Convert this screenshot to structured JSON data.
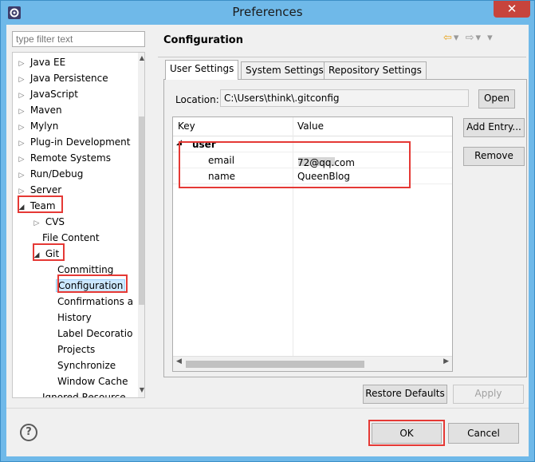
{
  "window": {
    "title": "Preferences",
    "close_glyph": "✕",
    "icon": "eclipse-gear-icon"
  },
  "filter": {
    "placeholder": "type filter text"
  },
  "tree": {
    "items": [
      {
        "label": "Java EE",
        "twisty": "▷"
      },
      {
        "label": "Java Persistence",
        "twisty": "▷"
      },
      {
        "label": "JavaScript",
        "twisty": "▷"
      },
      {
        "label": "Maven",
        "twisty": "▷"
      },
      {
        "label": "Mylyn",
        "twisty": "▷"
      },
      {
        "label": "Plug-in Development",
        "twisty": "▷"
      },
      {
        "label": "Remote Systems",
        "twisty": "▷"
      },
      {
        "label": "Run/Debug",
        "twisty": "▷"
      },
      {
        "label": "Server",
        "twisty": "▷"
      },
      {
        "label": "Team",
        "twisty": "◢"
      },
      {
        "label": "CVS",
        "twisty": "▷"
      },
      {
        "label": "File Content",
        "twisty": ""
      },
      {
        "label": "Git",
        "twisty": "◢"
      },
      {
        "label": "Committing",
        "twisty": ""
      },
      {
        "label": "Configuration",
        "twisty": ""
      },
      {
        "label": "Confirmations a",
        "twisty": ""
      },
      {
        "label": "History",
        "twisty": ""
      },
      {
        "label": "Label Decoratio",
        "twisty": ""
      },
      {
        "label": "Projects",
        "twisty": ""
      },
      {
        "label": "Synchronize",
        "twisty": ""
      },
      {
        "label": "Window Cache",
        "twisty": ""
      },
      {
        "label": "Ignored Resource",
        "twisty": ""
      }
    ]
  },
  "header": {
    "title": "Configuration"
  },
  "tabs": [
    {
      "label": "User Settings"
    },
    {
      "label": "System Settings"
    },
    {
      "label": "Repository Settings"
    }
  ],
  "location": {
    "label": "Location:",
    "value": "C:\\Users\\think\\.gitconfig",
    "open_label": "Open"
  },
  "table": {
    "col_key": "Key",
    "col_value": "Value",
    "section": "user",
    "rows": [
      {
        "key": "email",
        "value_prefix": "1",
        "value_suffix": "72@qq.com"
      },
      {
        "key": "name",
        "value": "QueenBlog"
      }
    ]
  },
  "side_buttons": {
    "add_entry": "Add Entry...",
    "remove": "Remove"
  },
  "footer": {
    "restore_defaults": "Restore Defaults",
    "apply": "Apply",
    "ok": "OK",
    "cancel": "Cancel",
    "help_glyph": "?"
  },
  "nav": {
    "back_glyph": "⇦",
    "forward_glyph": "⇨",
    "menu_glyph": "▾"
  },
  "colors": {
    "titlebar": "#6fb9e9",
    "highlight": "#e53935",
    "selection": "#cce8ff"
  }
}
